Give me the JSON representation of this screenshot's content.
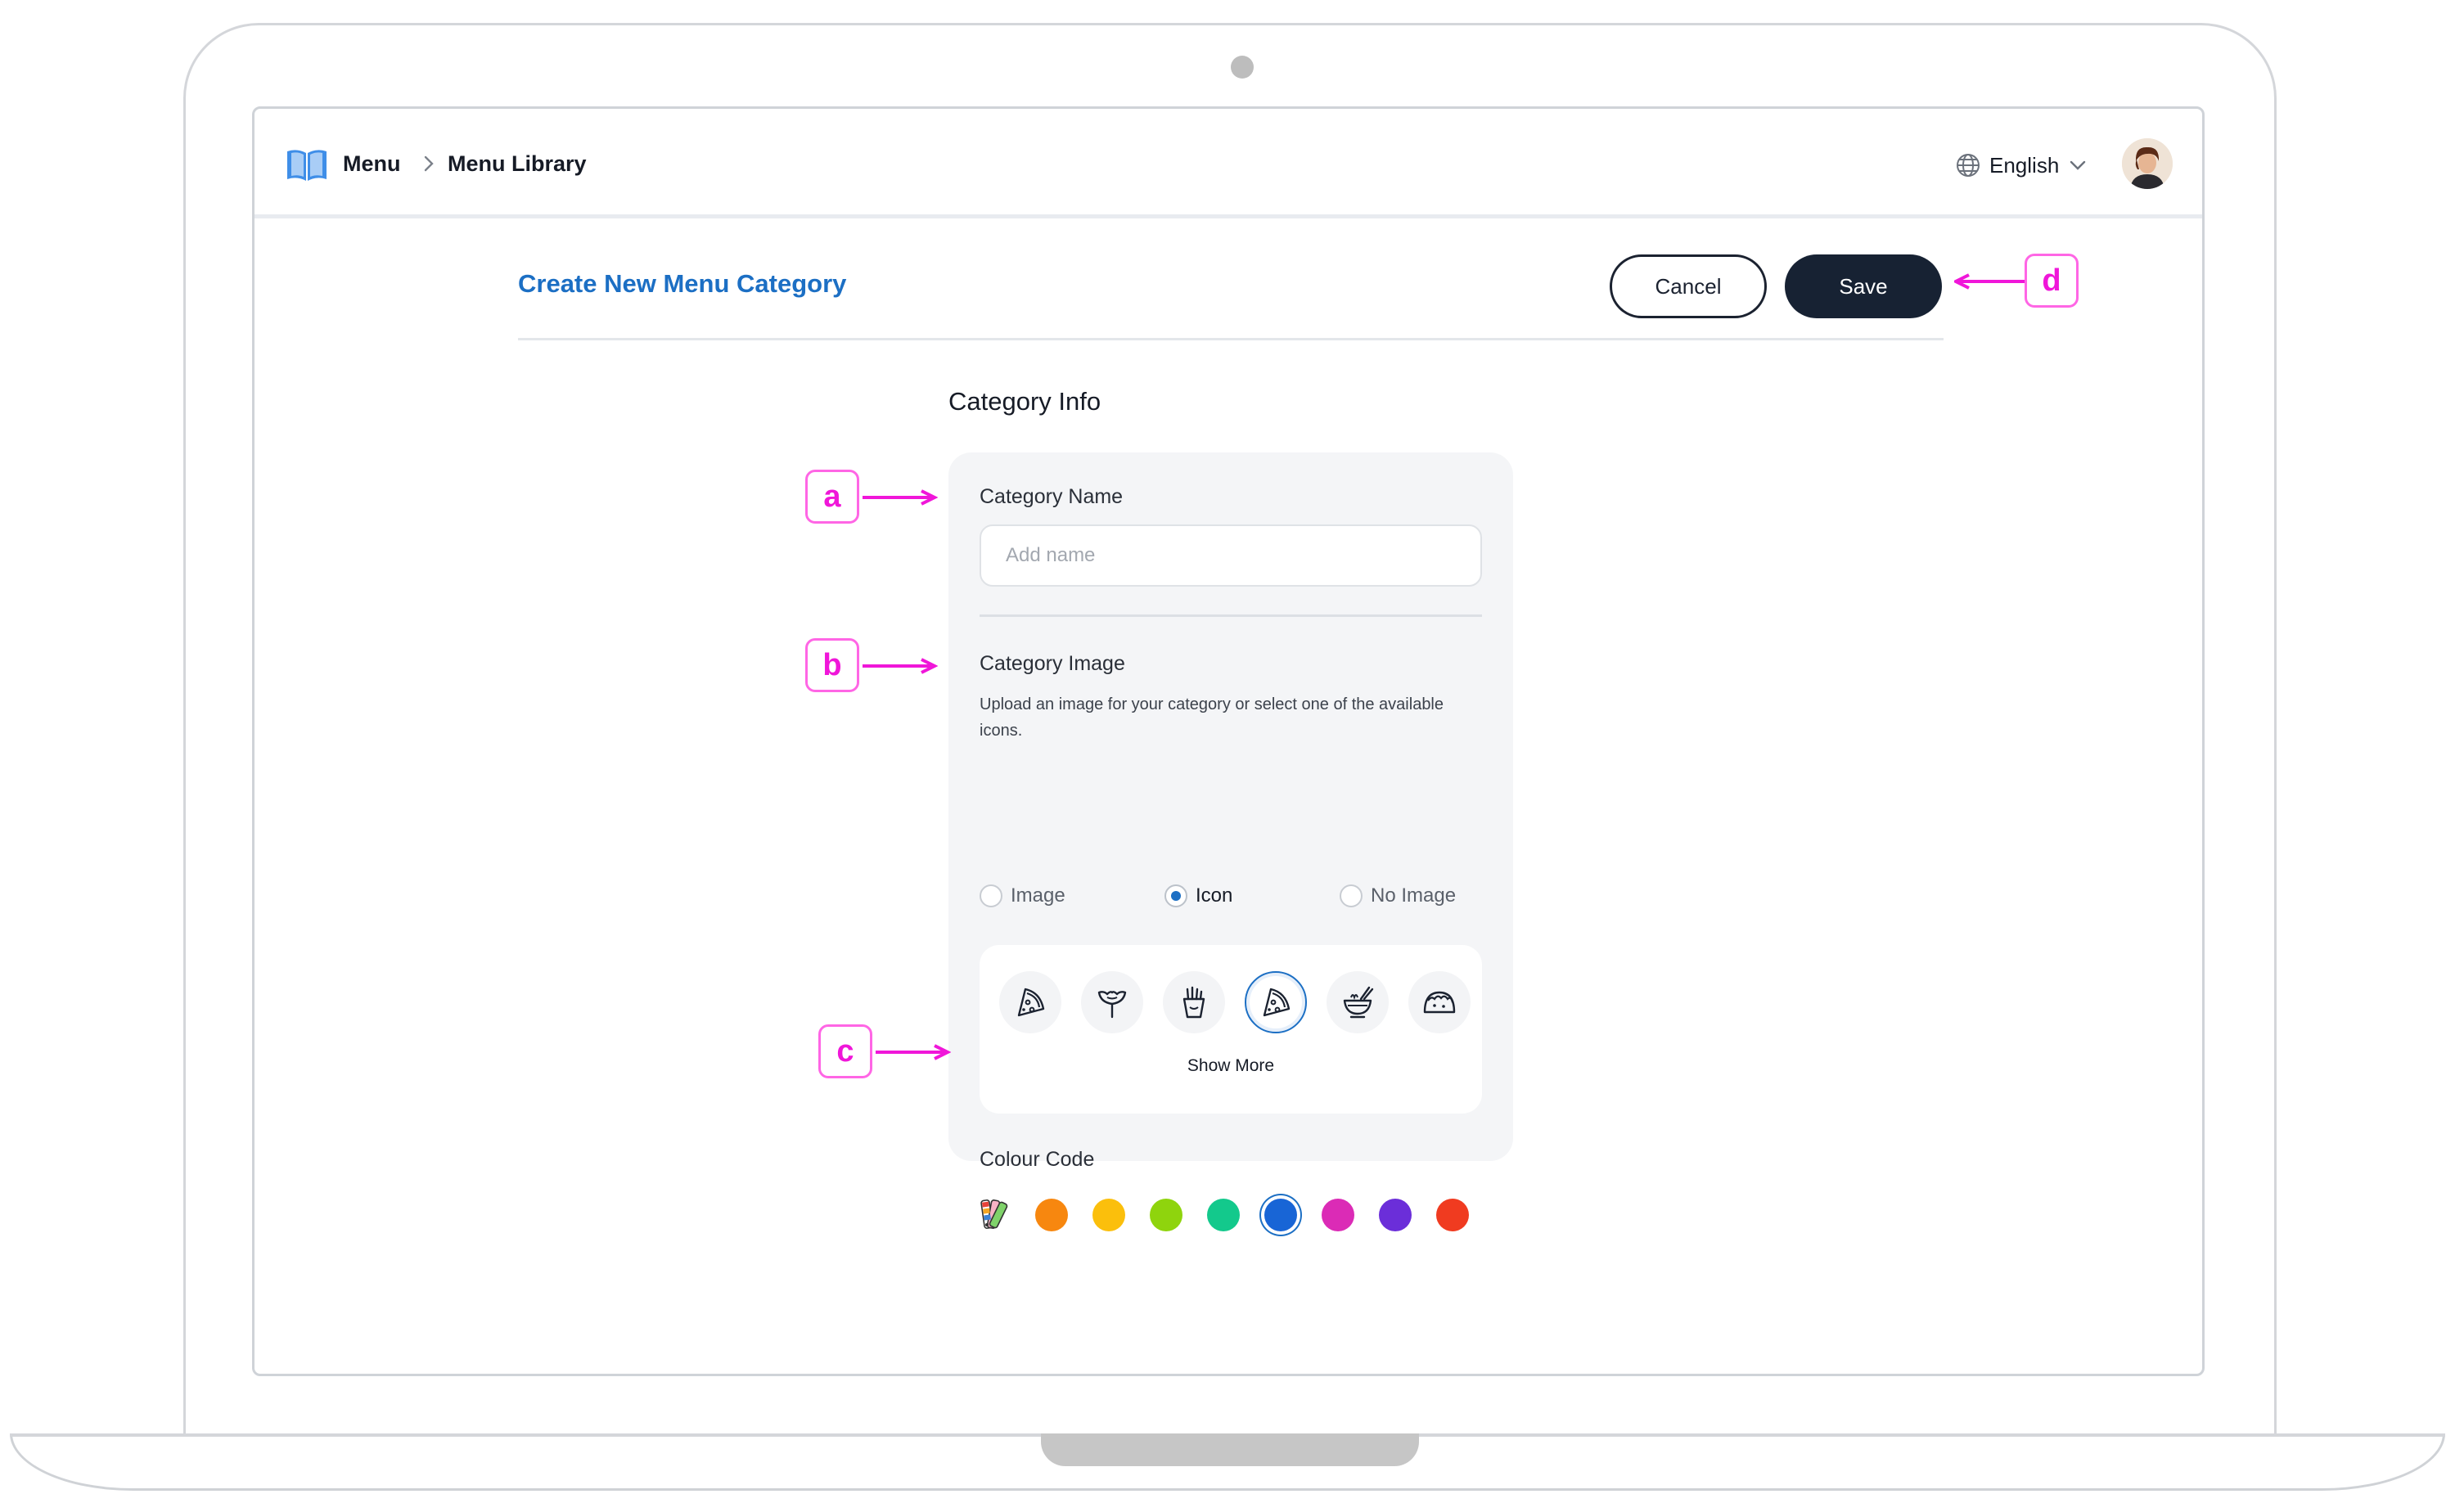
{
  "breadcrumb": {
    "root": "Menu",
    "current": "Menu Library"
  },
  "language": {
    "selected": "English"
  },
  "page": {
    "title": "Create New Menu Category"
  },
  "actions": {
    "cancel_label": "Cancel",
    "save_label": "Save"
  },
  "section": {
    "title": "Category Info"
  },
  "category_name": {
    "label": "Category Name",
    "placeholder": "Add name",
    "value": ""
  },
  "category_image": {
    "label": "Category Image",
    "help": "Upload an image for your category or select one of the available icons.",
    "options": [
      {
        "label": "Image",
        "checked": false
      },
      {
        "label": "Icon",
        "checked": true
      },
      {
        "label": "No Image",
        "checked": false
      }
    ],
    "icons": [
      "pizza-slice-icon",
      "meat-skewer-icon",
      "fries-icon",
      "pizza-slice-icon",
      "noodle-bowl-icon",
      "taco-icon"
    ],
    "selected_icon_index": 3,
    "show_more_label": "Show More"
  },
  "colour_code": {
    "label": "Colour Code",
    "colors": [
      "#f7870f",
      "#fbbf0c",
      "#8fd40d",
      "#13c98c",
      "#1865d6",
      "#db2bb6",
      "#6b2ed9",
      "#f03b20"
    ],
    "selected_index": 4
  },
  "callouts": {
    "a": "a",
    "b": "b",
    "c": "c",
    "d": "d"
  },
  "accent_color": "#f016d9"
}
